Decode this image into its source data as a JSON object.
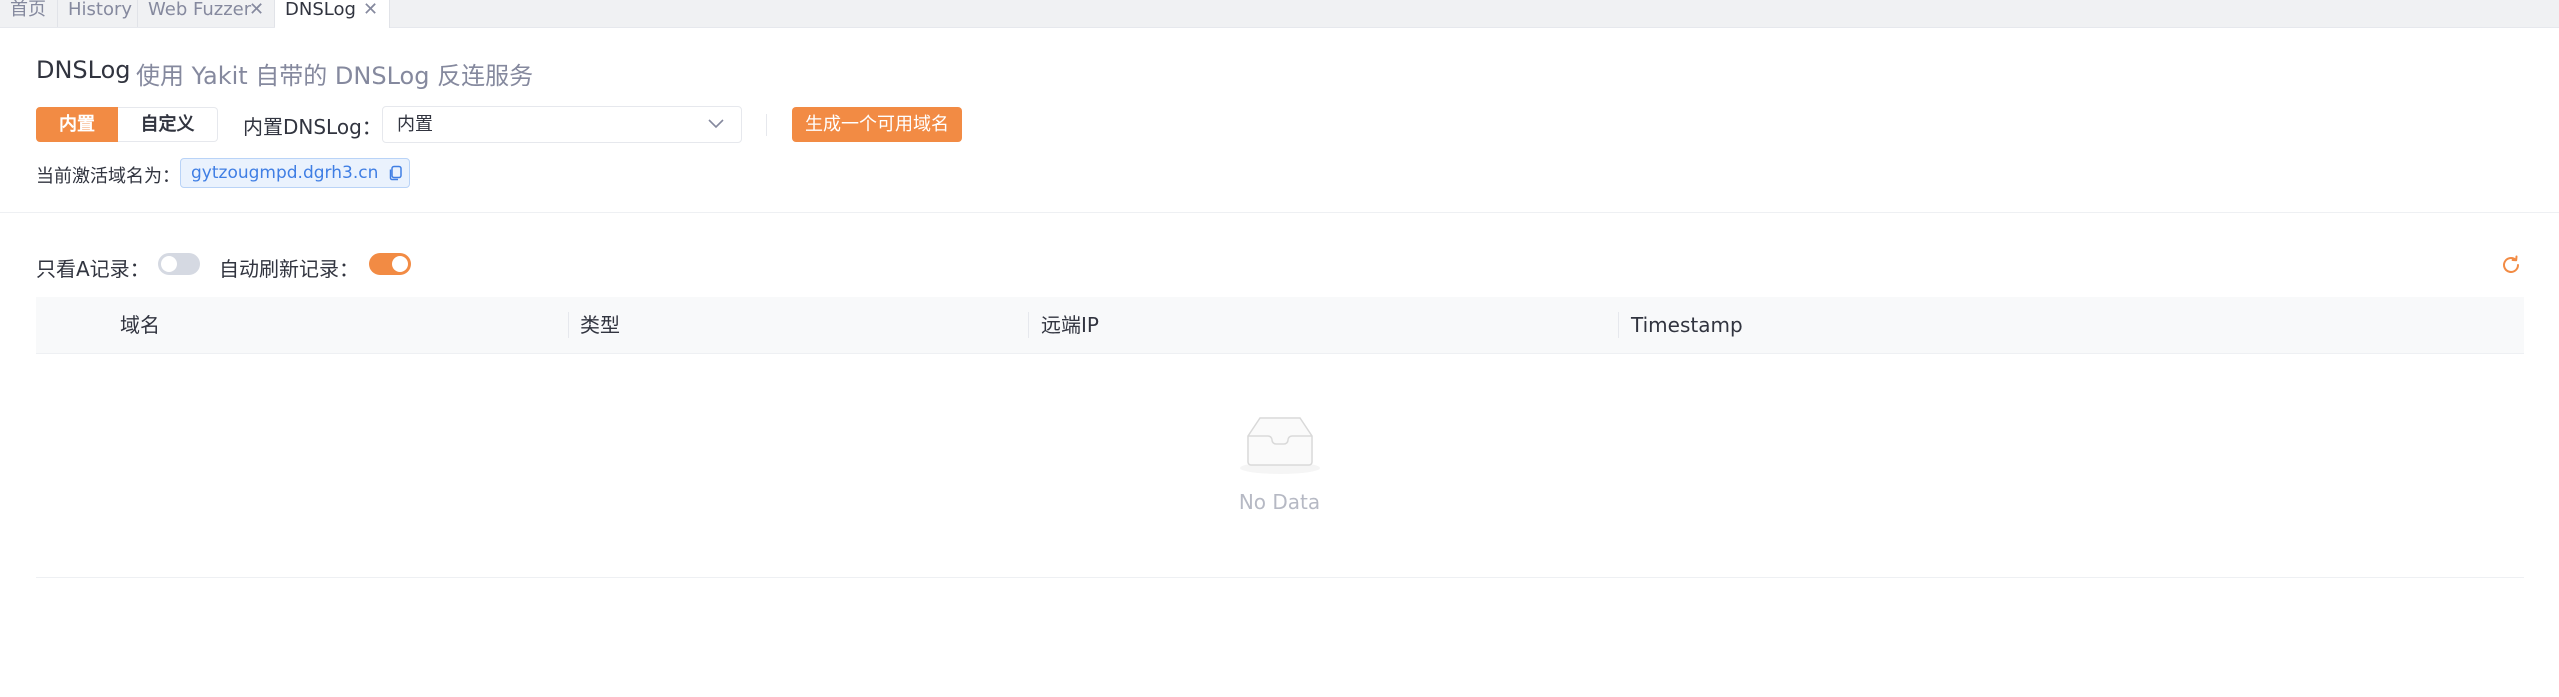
{
  "tabs": [
    {
      "label": "首页",
      "closable": false
    },
    {
      "label": "History",
      "closable": false
    },
    {
      "label": "Web Fuzzer",
      "closable": true
    },
    {
      "label": "DNSLog",
      "closable": true,
      "active": true
    }
  ],
  "header": {
    "title": "DNSLog",
    "subtitle": "使用 Yakit 自带的 DNSLog 反连服务"
  },
  "mode": {
    "builtin_label": "内置",
    "custom_label": "自定义",
    "selected": "内置"
  },
  "dnslog_select": {
    "label": "内置DNSLog：",
    "value": "内置"
  },
  "generate_button": "生成一个可用域名",
  "active_domain": {
    "label": "当前激活域名为：",
    "value": "gytzougmpd.dgrh3.cn"
  },
  "filters": {
    "only_a_label": "只看A记录：",
    "only_a_enabled": false,
    "auto_refresh_label": "自动刷新记录：",
    "auto_refresh_enabled": true
  },
  "table": {
    "columns": [
      "域名",
      "类型",
      "远端IP",
      "Timestamp"
    ],
    "rows": [],
    "empty_text": "No Data"
  },
  "icons": {
    "close": "close-icon",
    "chevron": "chevron-down-icon",
    "copy": "copy-icon",
    "refresh": "refresh-icon",
    "empty": "empty-inbox-icon"
  },
  "colors": {
    "accent": "#f28b44",
    "link": "#3f7ee4",
    "text": "#31343f",
    "muted": "#85899e"
  }
}
